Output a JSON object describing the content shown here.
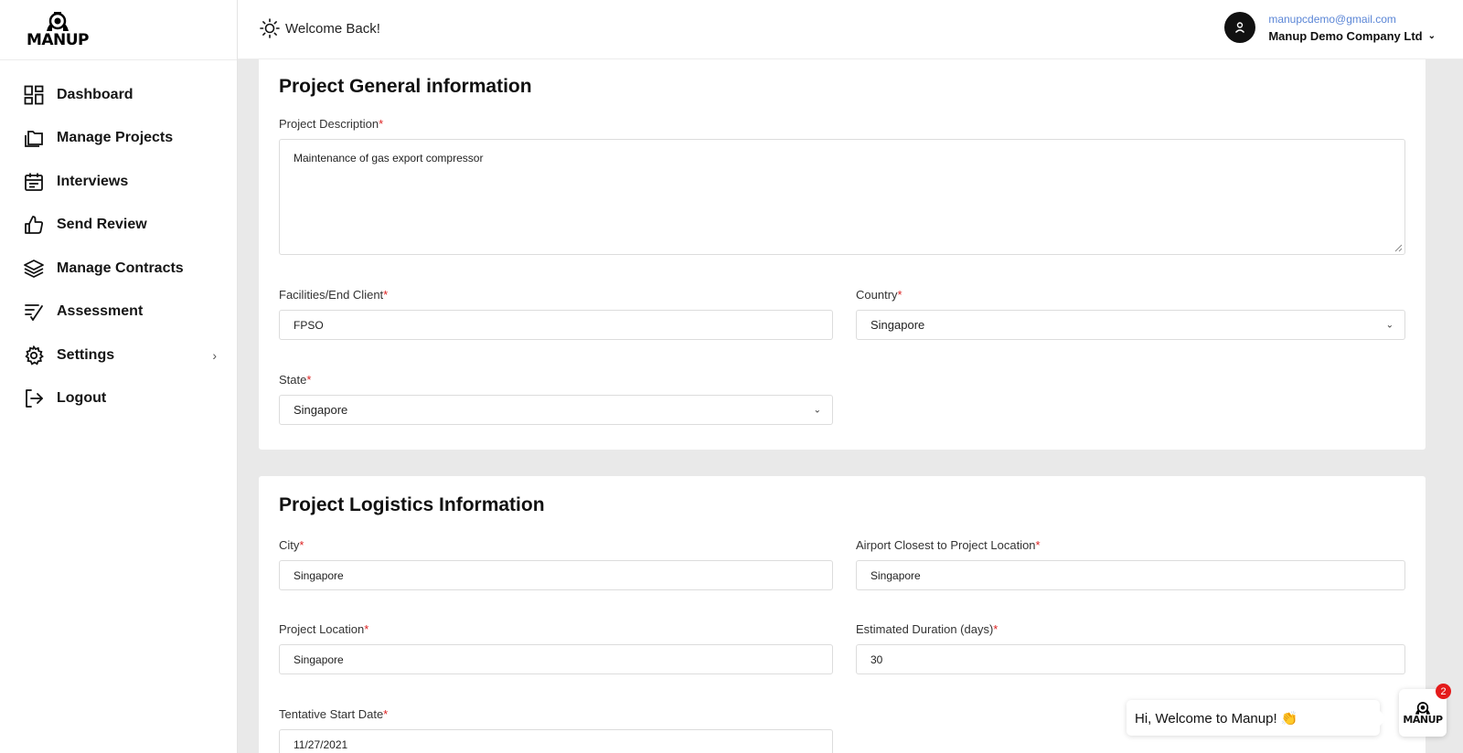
{
  "brand": {
    "name": "MANUP"
  },
  "sidebar": {
    "items": [
      {
        "label": "Dashboard",
        "icon": "dashboard-grid-icon"
      },
      {
        "label": "Manage Projects",
        "icon": "folders-icon"
      },
      {
        "label": "Interviews",
        "icon": "calendar-icon"
      },
      {
        "label": "Send Review",
        "icon": "thumbs-up-icon"
      },
      {
        "label": "Manage Contracts",
        "icon": "layers-icon"
      },
      {
        "label": "Assessment",
        "icon": "checklist-icon"
      },
      {
        "label": "Settings",
        "icon": "gear-icon",
        "has_submenu": true
      },
      {
        "label": "Logout",
        "icon": "logout-icon"
      }
    ]
  },
  "header": {
    "welcome": "Welcome Back!",
    "user_email": "manupcdemo@gmail.com",
    "company": "Manup Demo Company Ltd"
  },
  "general": {
    "title": "Project General information",
    "description_label": "Project Description",
    "description_value": "Maintenance of gas export compressor",
    "facilities_label": "Facilities/End Client",
    "facilities_value": "FPSO",
    "country_label": "Country",
    "country_value": "Singapore",
    "state_label": "State",
    "state_value": "Singapore"
  },
  "logistics": {
    "title": "Project Logistics Information",
    "city_label": "City",
    "city_value": "Singapore",
    "airport_label": "Airport Closest to Project Location",
    "airport_value": "Singapore",
    "location_label": "Project Location",
    "location_value": "Singapore",
    "duration_label": "Estimated Duration (days)",
    "duration_value": "30",
    "start_label": "Tentative Start Date",
    "start_value": "11/27/2021"
  },
  "required_mark": "*",
  "chat": {
    "greeting": "Hi, Welcome to Manup! 👏",
    "badge_count": "2",
    "launcher_text": "MANUP"
  },
  "colors": {
    "accent_link": "#5b86d6",
    "required": "#dd2222",
    "badge": "#e41b1b"
  }
}
